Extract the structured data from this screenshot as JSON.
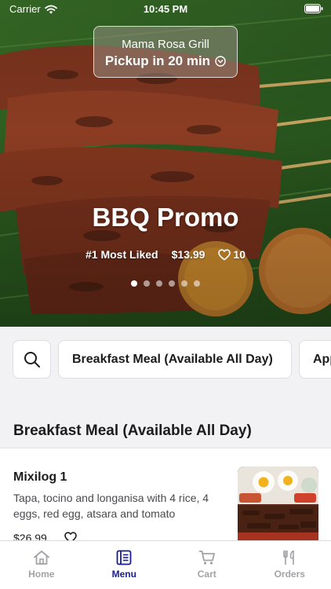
{
  "status_bar": {
    "carrier": "Carrier",
    "time": "10:45 PM"
  },
  "store": {
    "name": "Mama Rosa Grill",
    "pickup": "Pickup in 20 min"
  },
  "promo": {
    "title": "BBQ Promo",
    "badge": "#1 Most Liked",
    "price": "$13.99",
    "likes": "10",
    "slide_count": 6,
    "active_slide": 1
  },
  "categories": [
    {
      "label": "Breakfast Meal (Available All Day)"
    },
    {
      "label": "App"
    }
  ],
  "section": {
    "title": "Breakfast Meal (Available All Day)"
  },
  "menu_items": [
    {
      "name": "Mixilog 1",
      "description": "Tapa, tocino and longanisa with 4 rice, 4 eggs, red egg, atsara and tomato",
      "price": "$26.99"
    }
  ],
  "tabs": [
    {
      "label": "Home",
      "icon": "home-icon",
      "active": false
    },
    {
      "label": "Menu",
      "icon": "menu-icon",
      "active": true
    },
    {
      "label": "Cart",
      "icon": "cart-icon",
      "active": false
    },
    {
      "label": "Orders",
      "icon": "orders-icon",
      "active": false
    }
  ],
  "colors": {
    "accent": "#1a1d8f",
    "inactive_tab": "#a2a2a7",
    "background": "#f2f2f4"
  }
}
